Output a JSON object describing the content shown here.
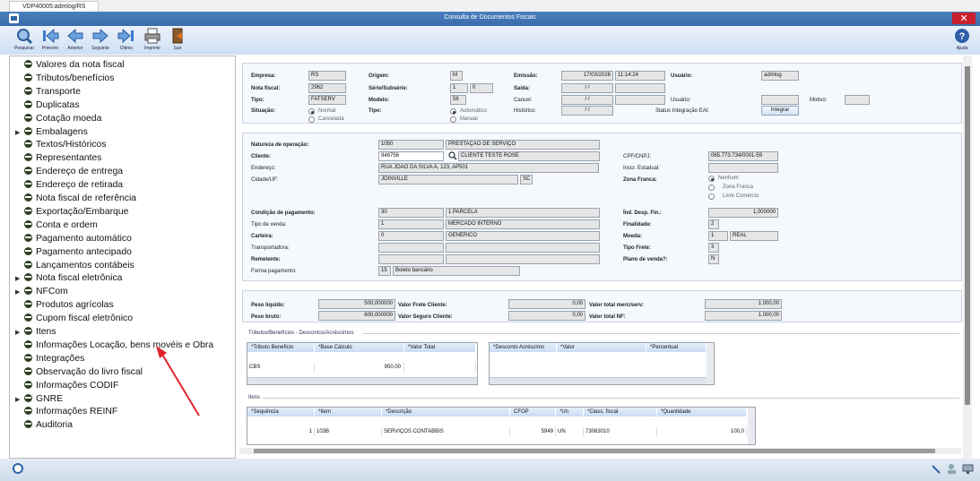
{
  "tab": {
    "label": "VDP40005:admlog/RS"
  },
  "window": {
    "title": "Consulta de Documentos Fiscais",
    "close": "✕"
  },
  "toolbar": {
    "pesquisar": "Pesquisar",
    "primeiro": "Primeiro",
    "anterior": "Anterior",
    "seguinte": "Seguinte",
    "ultimo": "Último",
    "imprimir": "Imprimir",
    "sair": "Sair",
    "ajuda": "Ajuda"
  },
  "sidebar": {
    "items": [
      {
        "label": "Valores da nota fiscal",
        "arrow": ""
      },
      {
        "label": "Tributos/benefícios",
        "arrow": ""
      },
      {
        "label": "Transporte",
        "arrow": ""
      },
      {
        "label": "Duplicatas",
        "arrow": ""
      },
      {
        "label": "Cotação moeda",
        "arrow": ""
      },
      {
        "label": "Embalagens",
        "arrow": "▶"
      },
      {
        "label": "Textos/Históricos",
        "arrow": ""
      },
      {
        "label": "Representantes",
        "arrow": ""
      },
      {
        "label": "Endereço de entrega",
        "arrow": ""
      },
      {
        "label": "Endereço de retirada",
        "arrow": ""
      },
      {
        "label": "Nota fiscal de referência",
        "arrow": ""
      },
      {
        "label": "Exportação/Embarque",
        "arrow": ""
      },
      {
        "label": "Conta e ordem",
        "arrow": ""
      },
      {
        "label": "Pagamento automático",
        "arrow": ""
      },
      {
        "label": "Pagamento antecipado",
        "arrow": ""
      },
      {
        "label": "Lançamentos contábeis",
        "arrow": ""
      },
      {
        "label": "Nota fiscal eletrônica",
        "arrow": "▶"
      },
      {
        "label": "NFCom",
        "arrow": "▶"
      },
      {
        "label": "Produtos agrícolas",
        "arrow": ""
      },
      {
        "label": "Cupom fiscal eletrônico",
        "arrow": ""
      },
      {
        "label": "Itens",
        "arrow": "▶"
      },
      {
        "label": "Informações Locação, bens movéis e Obra",
        "arrow": ""
      },
      {
        "label": "Integrações",
        "arrow": ""
      },
      {
        "label": "Observação do livro fiscal",
        "arrow": ""
      },
      {
        "label": "Informações CODIF",
        "arrow": ""
      },
      {
        "label": "GNRE",
        "arrow": "▶"
      },
      {
        "label": "Informações REINF",
        "arrow": ""
      },
      {
        "label": "Auditoria",
        "arrow": ""
      }
    ]
  },
  "header": {
    "empresa_lbl": "Empresa:",
    "empresa": "RS",
    "origem_lbl": "Origem:",
    "origem": "M",
    "emissao_lbl": "Emissão:",
    "emissao_data": "17/03/2026",
    "emissao_hora": "11:14:24",
    "usuario_lbl": "Usuário:",
    "usuario": "admlog",
    "nota_lbl": "Nota fiscal:",
    "nota": "2962",
    "serie_lbl": "Série/Subsérie:",
    "serie": "1",
    "subserie": "0",
    "saida_lbl": "Saída:",
    "saida": "/  /",
    "tipo_lbl": "Tipo:",
    "tipo": "FATSERV",
    "modelo_lbl": "Modelo:",
    "modelo": "56",
    "cancel_lbl": "Cancel:",
    "cancel": "/  /",
    "usuario2_lbl": "Usuário:",
    "motivo_lbl": "Motivo:",
    "situacao_lbl": "Situação:",
    "normal": "Normal",
    "cancelada": "Cancelada",
    "tipo2_lbl": "Tipo:",
    "automatico": "Automático",
    "manual": "Manual",
    "historico_lbl": "Histórico:",
    "historico": "/  /",
    "status_eai_lbl": "Status Integração EAI:",
    "integrar": "Integrar"
  },
  "cliente": {
    "natureza_lbl": "Natureza de operação:",
    "natureza_cod": "1050",
    "natureza_desc": "PRESTAÇÃO DE SERVIÇO",
    "cliente_lbl": "Cliente:",
    "cliente_cod": "948756",
    "cliente_nome": "CLIENTE TESTE ROSE",
    "cpf_lbl": "CPF/CNPJ:",
    "cpf": "065.773.734/0001-59",
    "endereco_lbl": "Endereço:",
    "endereco": "RUA JOAO DA SILVA  A, 123, AP501",
    "inscr_lbl": "Inscr. Estadual:",
    "cidade_lbl": "Cidade/UF:",
    "cidade": "JOINVILLE",
    "uf": "SC",
    "zona_lbl": "Zona Franca:",
    "zona_nenhum": "Nenhum",
    "zona_franca": "Zona Franca",
    "zona_livre": "Livre Comércio",
    "cond_lbl": "Condição de pagamento:",
    "cond_cod": "30",
    "cond_desc": "1 PARCELA",
    "ind_lbl": "Índ. Desp. Fin.:",
    "ind": "1,000000",
    "tipovenda_lbl": "Tipo de venda:",
    "tipovenda_cod": "1",
    "tipovenda_desc": "MERCADO INTERNO",
    "finalidade_lbl": "Finalidade:",
    "finalidade": "2",
    "carteira_lbl": "Carteira:",
    "carteira_cod": "0",
    "carteira_desc": "GENÉRICO",
    "moeda_lbl": "Moeda:",
    "moeda_cod": "1",
    "moeda_desc": "REAL",
    "transp_lbl": "Transportadora:",
    "tipofrete_lbl": "Tipo Frete:",
    "tipofrete": "3",
    "remetente_lbl": "Remetente:",
    "plano_lbl": "Plano de venda?:",
    "plano": "N",
    "forma_lbl": "Forma pagamento:",
    "forma_cod": "15",
    "forma_desc": "Boleto bancário"
  },
  "valores": {
    "peso_liq_lbl": "Peso líquido:",
    "peso_liq": "500,000000",
    "frete_lbl": "Valor Frete Cliente:",
    "frete": "0,00",
    "total_merc_lbl": "Valor total merc/serv:",
    "total_merc": "1.000,00",
    "peso_bruto_lbl": "Peso bruto:",
    "peso_bruto": "600,000000",
    "seguro_lbl": "Valor Seguro Cliente:",
    "seguro": "0,00",
    "total_nf_lbl": "Valor total NF:",
    "total_nf": "1.000,00"
  },
  "tributos": {
    "title": "Tributos/Benefícios - Descontos/Acréscimos",
    "cols": [
      "*Tributo Benefício",
      "*Base Cálculo",
      "*Valor Total"
    ],
    "row": [
      "CBS",
      "950,00",
      ""
    ],
    "cols2": [
      "*Desconto Acréscimo",
      "*Valor",
      "*Percentual"
    ]
  },
  "itens": {
    "title": "Itens",
    "cols": [
      "*Sequência",
      "*Item",
      "*Descrição",
      "CFOP",
      "*Un",
      "*Class. fiscal",
      "*Quantidade"
    ],
    "row": [
      "1",
      "103B",
      "SERVIÇOS CONTABBIS",
      "5949",
      "UN",
      "73063010",
      "100,0"
    ]
  },
  "colors": {
    "titlebar": "#3a6bab",
    "close": "#c8202c",
    "arrow": "#e0242a"
  }
}
